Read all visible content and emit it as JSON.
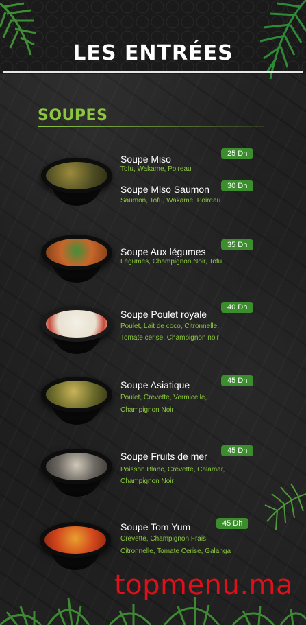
{
  "header": {
    "title": "LES ENTRÉES"
  },
  "section": {
    "title": "SOUPES"
  },
  "items": [
    {
      "name": "Soupe Miso",
      "price": "25 Dh",
      "desc1": "Tofu, Wakame, Poireau",
      "desc2": ""
    },
    {
      "name": "Soupe Miso Saumon",
      "price": "30 Dh",
      "desc1": "Saumon, Tofu, Wakame, Poireau",
      "desc2": ""
    },
    {
      "name": "Soupe Aux légumes",
      "price": "35 Dh",
      "desc1": "Légumes, Champignon Noir, Tofu",
      "desc2": ""
    },
    {
      "name": "Soupe Poulet royale",
      "price": "40 Dh",
      "desc1": "Poulet, Lait de coco, Citronnelle,",
      "desc2": "Tomate cerise, Champignon noir"
    },
    {
      "name": "Soupe Asiatique",
      "price": "45 Dh",
      "desc1": "Poulet, Crevette, Vermicelle,",
      "desc2": "Champignon Noir"
    },
    {
      "name": "Soupe Fruits de mer",
      "price": "45 Dh",
      "desc1": "Poisson Blanc, Crevette, Calamar,",
      "desc2": "Champignon Noir"
    },
    {
      "name": "Soupe Tom Yum",
      "price": "45 Dh",
      "desc1": "Crevette, Champignon Frais,",
      "desc2": "Citronnelle, Tomate Cerise, Galanga"
    }
  ],
  "watermark": "topmenu.ma",
  "colors": {
    "accent": "#8cc63f",
    "price_badge": "#3b8d2e",
    "watermark": "#e0101a"
  }
}
